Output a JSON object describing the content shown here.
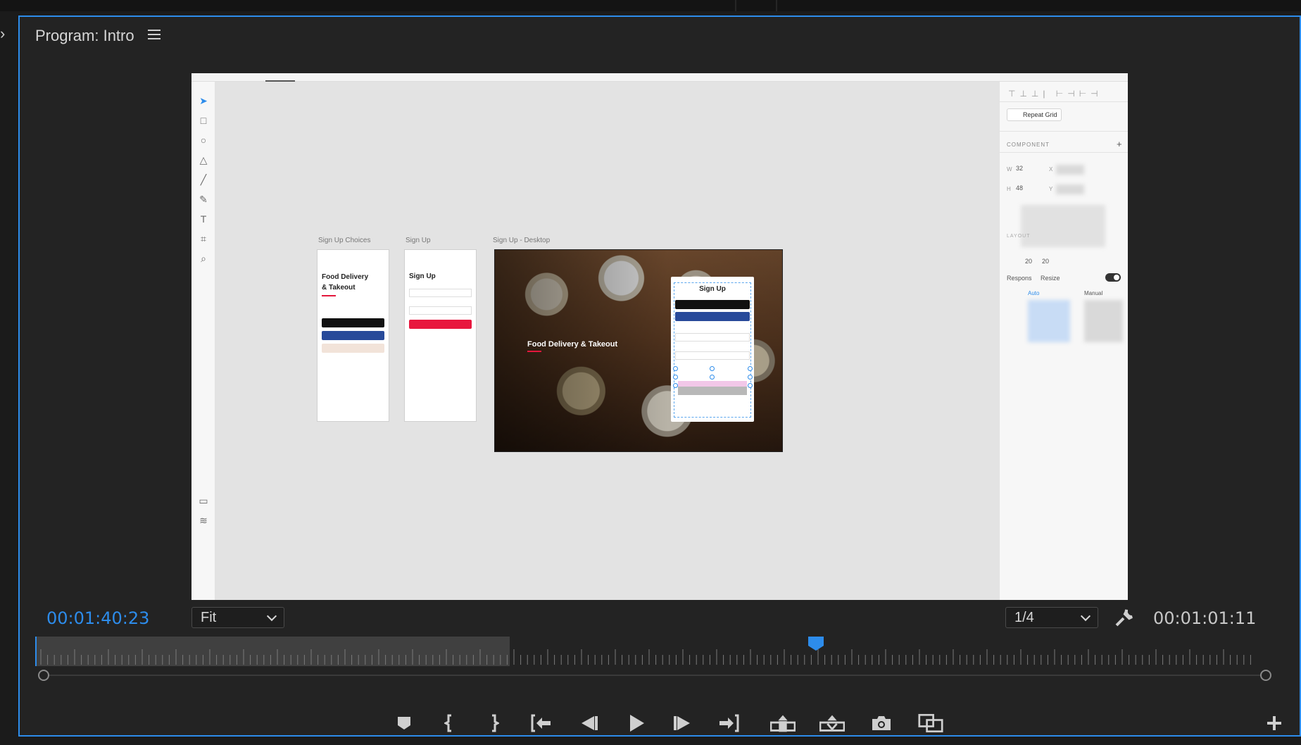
{
  "panel": {
    "title": "Program: Intro"
  },
  "frame_content": {
    "artboards": [
      {
        "label": "Sign Up Choices",
        "title_line1": "Food Delivery",
        "title_line2": "& Takeout"
      },
      {
        "label": "Sign Up",
        "title": "Sign Up"
      },
      {
        "label": "Sign Up - Desktop",
        "hero_title": "Food Delivery & Takeout",
        "modal_title": "Sign Up"
      }
    ],
    "inspector": {
      "repeat_grid": "Repeat Grid",
      "component_header": "COMPONENT",
      "w_label": "W",
      "w_value": "32",
      "h_label": "H",
      "h_value": "48",
      "x_label": "X",
      "y_label": "Y",
      "layout_header": "LAYOUT",
      "padding_1": "20",
      "padding_2": "20",
      "responsive_label": "Respons",
      "resize_label": "Resize",
      "auto_label": "Auto",
      "manual_label": "Manual"
    }
  },
  "controls": {
    "current_timecode": "00:01:40:23",
    "zoom_select": "Fit",
    "resolution_select": "1/4",
    "duration_timecode": "00:01:01:11"
  },
  "icons": {
    "menu": "hamburger-menu-icon",
    "wrench": "wrench-icon",
    "marker": "add-marker-icon",
    "mark_in": "mark-in-icon",
    "mark_out": "mark-out-icon",
    "go_in": "go-to-in-icon",
    "step_back": "step-back-icon",
    "play": "play-icon",
    "step_forward": "step-forward-icon",
    "go_out": "go-to-out-icon",
    "lift": "lift-icon",
    "extract": "extract-icon",
    "export_frame": "camera-icon",
    "compare": "comparison-view-icon",
    "add": "plus-icon"
  },
  "colors": {
    "accent": "#2d8ceb",
    "panel_bg": "#232323",
    "brand_red": "#e3173c"
  }
}
